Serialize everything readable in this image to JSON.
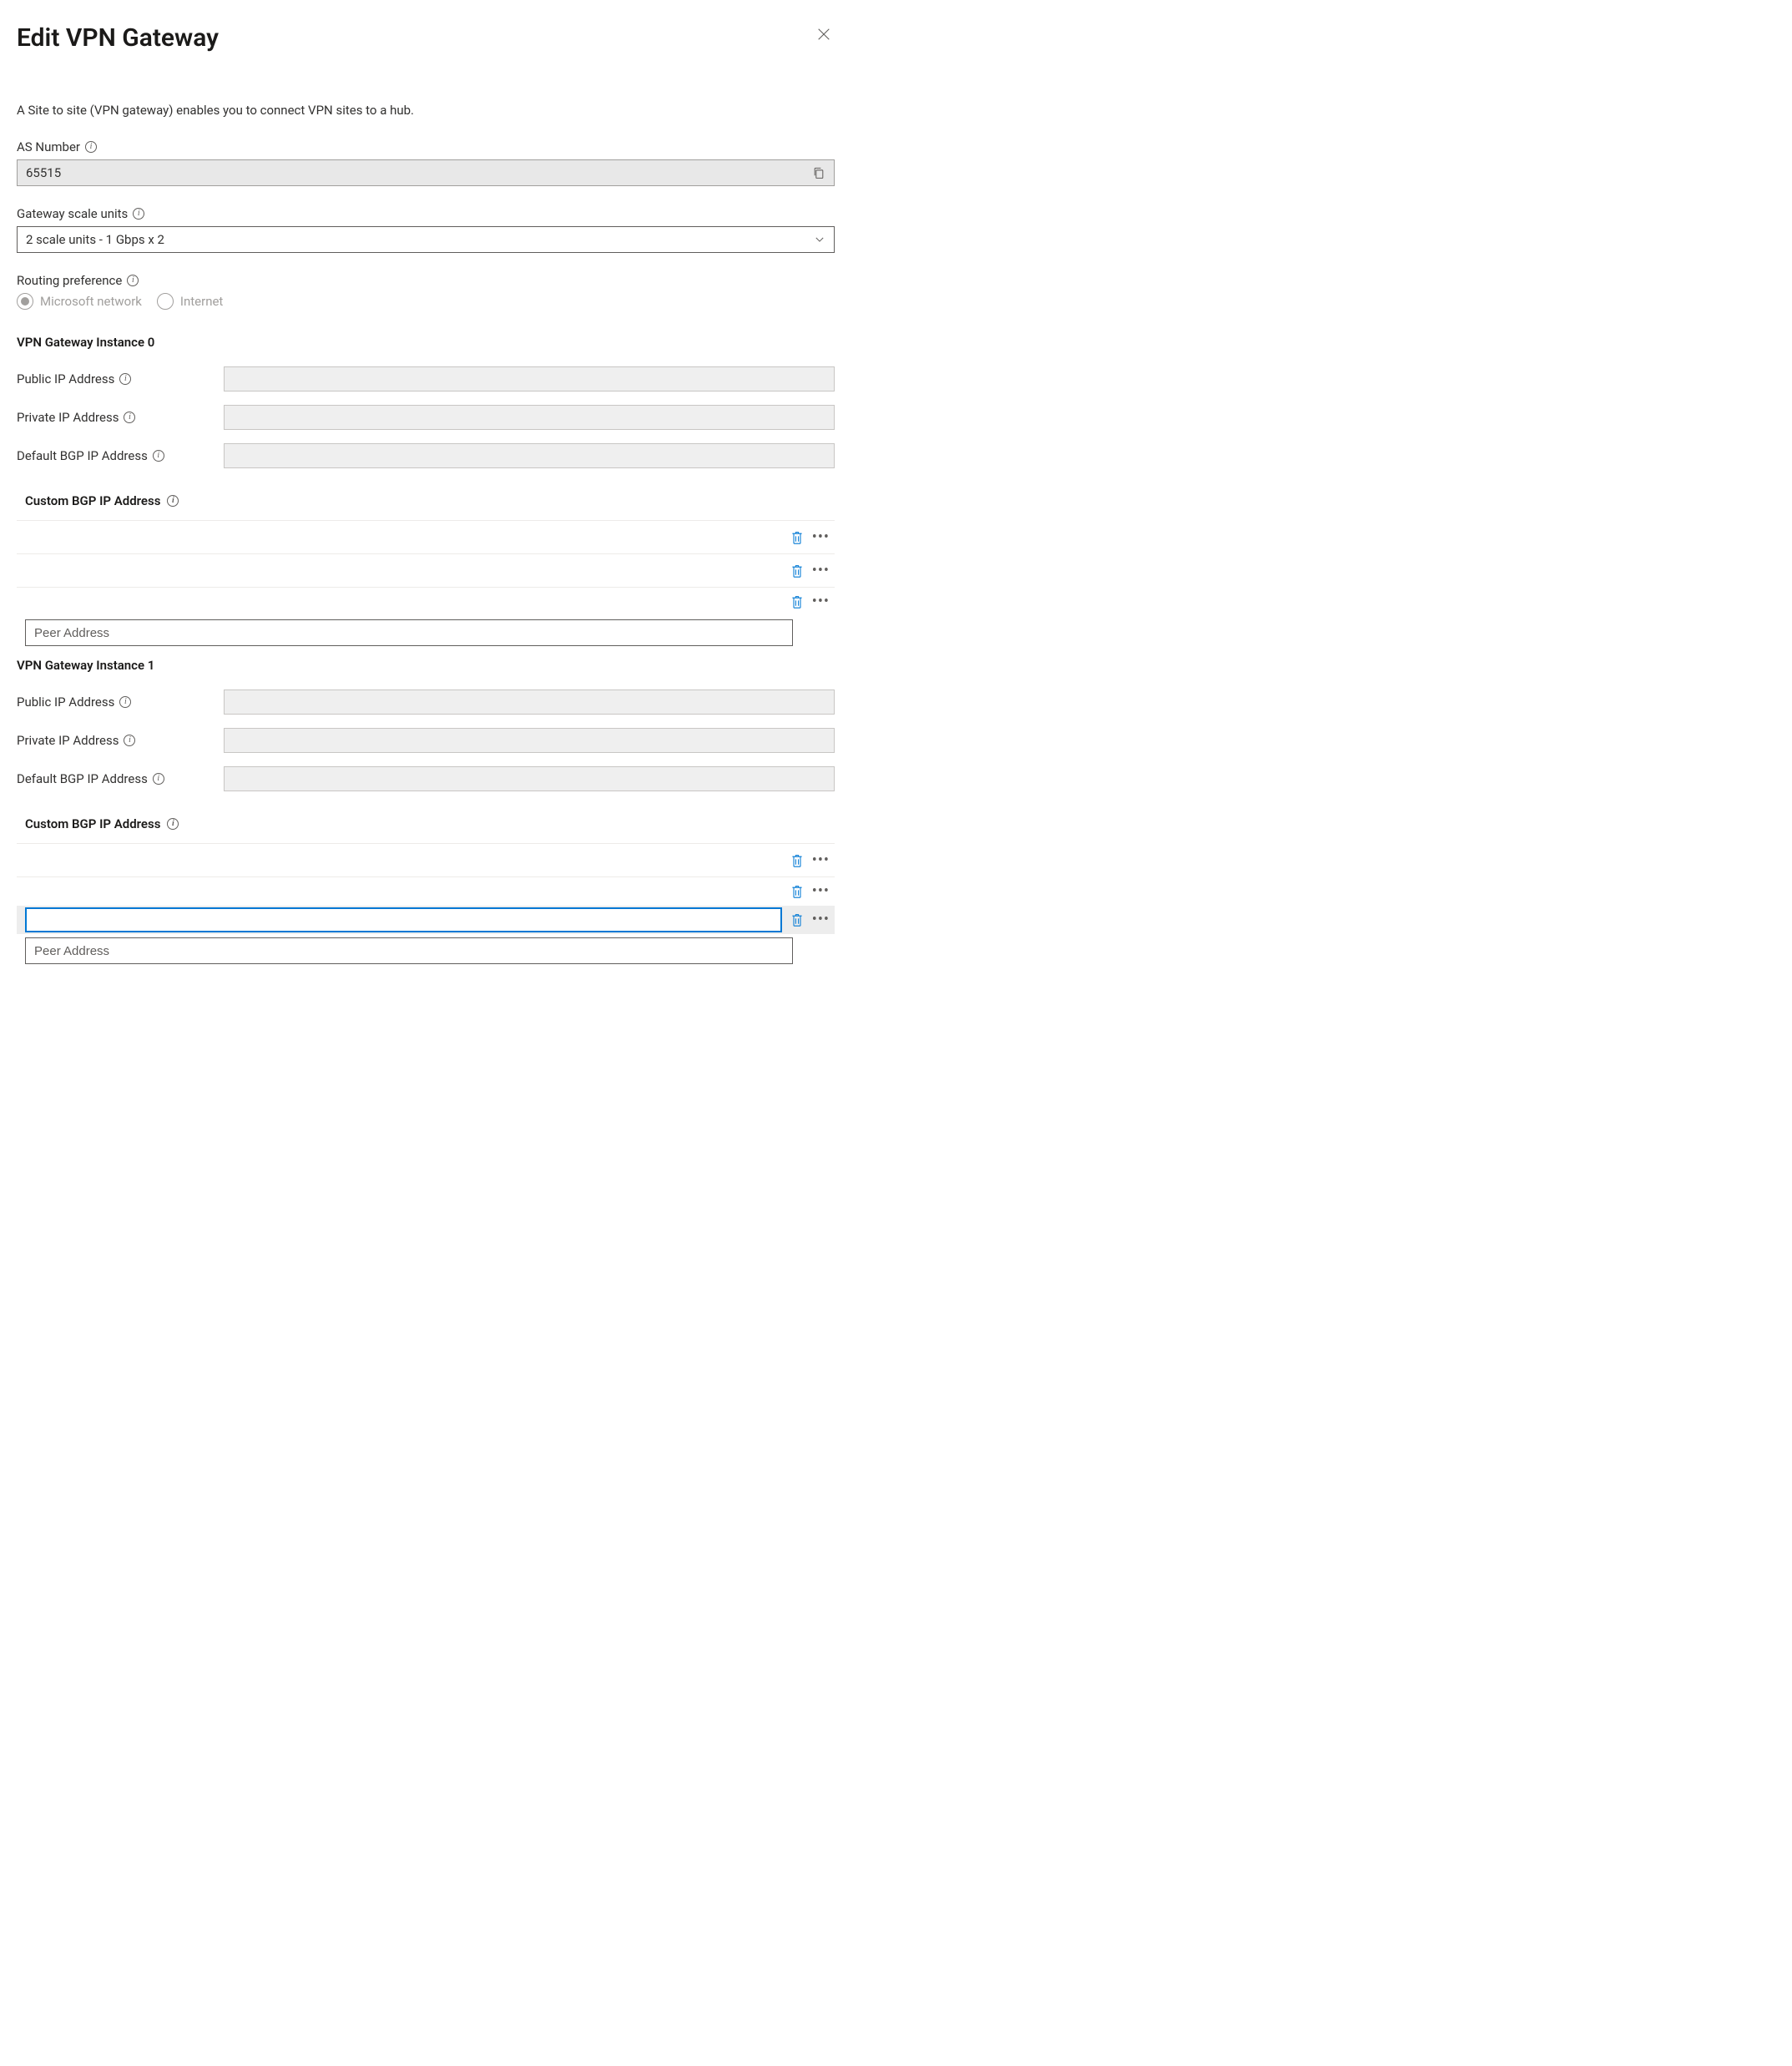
{
  "header": {
    "title": "Edit VPN Gateway"
  },
  "description": "A Site to site (VPN gateway) enables you to connect VPN sites to a hub.",
  "asNumber": {
    "label": "AS Number",
    "value": "65515"
  },
  "scaleUnits": {
    "label": "Gateway scale units",
    "value": "2 scale units - 1 Gbps x 2"
  },
  "routingPref": {
    "label": "Routing preference",
    "opt1": "Microsoft network",
    "opt2": "Internet"
  },
  "instance0": {
    "heading": "VPN Gateway Instance 0",
    "publicIpLabel": "Public IP Address",
    "privateIpLabel": "Private IP Address",
    "defaultBgpLabel": "Default BGP IP Address",
    "customBgpLabel": "Custom BGP IP Address",
    "peerPlaceholder": "Peer Address"
  },
  "instance1": {
    "heading": "VPN Gateway Instance 1",
    "publicIpLabel": "Public IP Address",
    "privateIpLabel": "Private IP Address",
    "defaultBgpLabel": "Default BGP IP Address",
    "customBgpLabel": "Custom BGP IP Address",
    "peerPlaceholder": "Peer Address"
  }
}
